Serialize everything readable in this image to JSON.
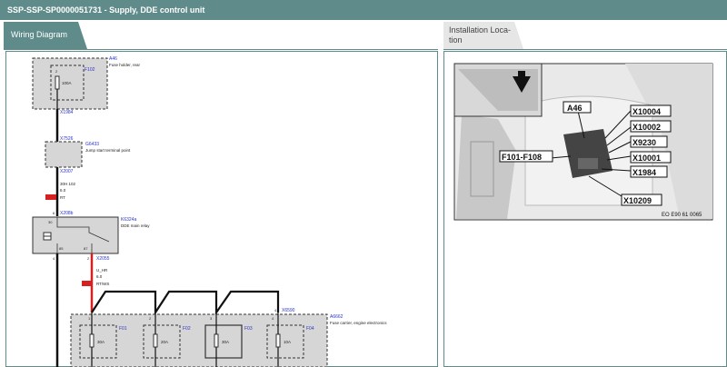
{
  "window": {
    "title": "SSP-SSP-SP0000051731  -  Supply, DDE control unit"
  },
  "tabs": {
    "wiring": "Wiring Diagram",
    "installation": [
      "Installation Loca-",
      "tion"
    ]
  },
  "wiring": {
    "a46": {
      "id": "A46",
      "name": "Fuse holder, rear"
    },
    "f102": {
      "id": "F102",
      "amp": "100A",
      "pin": "2"
    },
    "conn_x1984": "X1984",
    "conn_x7526": "X7526",
    "g6433": {
      "id": "G6433",
      "name": "Jump start terminal point"
    },
    "conn_x2007": "X2007",
    "wire1": {
      "code": "30H 102",
      "size": "6.0",
      "color": "RT"
    },
    "conn_x208b": {
      "id": "X208b",
      "pin": "6"
    },
    "k6324": {
      "id": "K6324a",
      "name": "DDE main relay",
      "pin_top": "30",
      "pin_left": "85",
      "pin_right": "87",
      "pin_bottom_left": "4",
      "pin_bottom_right": "2"
    },
    "conn_x2055": "X2055",
    "wire2": {
      "code": "U_HR",
      "size": "6.0",
      "color": "RT/WS"
    },
    "conn_x6590": {
      "id": "X6590",
      "pin": "4"
    },
    "a6662": {
      "id": "A6662",
      "name": "Fuse carrier, engine electronics"
    },
    "fuses": [
      {
        "id": "F01",
        "amp": "30A",
        "pin": "1"
      },
      {
        "id": "F02",
        "amp": "20A",
        "pin": "2"
      },
      {
        "id": "F03",
        "amp": "30A",
        "pin": "3"
      },
      {
        "id": "F04",
        "amp": "10A",
        "pin": "4"
      }
    ]
  },
  "installation": {
    "labels": [
      "A46",
      "X10004",
      "X10002",
      "X9230",
      "X10001",
      "X1984",
      "X10209",
      "F101-F108"
    ],
    "figure_code": "EO E90 61 0065"
  },
  "colors": {
    "accent": "#5f8c8a",
    "wire_red": "#d42020",
    "link_blue": "#2a35c8"
  }
}
